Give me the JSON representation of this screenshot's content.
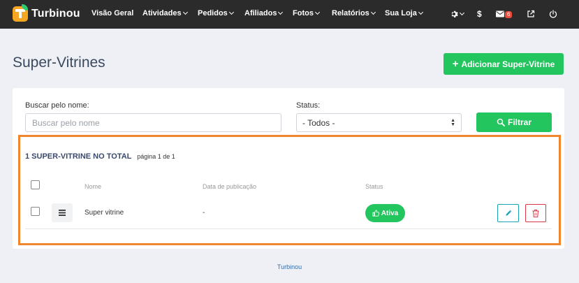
{
  "navbar": {
    "brand": "Turbinou",
    "items": [
      {
        "label": "Visão Geral"
      },
      {
        "label": "Atividades"
      },
      {
        "label": "Pedidos"
      },
      {
        "label": "Afiliados"
      },
      {
        "label": "Fotos"
      },
      {
        "label": "Relatórios"
      },
      {
        "label": "Sua Loja"
      }
    ],
    "icons": {
      "settings": "gear-icon",
      "billing": "dollar-icon",
      "messages": "envelope-icon",
      "external": "external-link-icon",
      "logout": "power-icon"
    },
    "messages_count": "6"
  },
  "page": {
    "title": "Super-Vitrines",
    "add_button": "Adicionar Super-Vitrine"
  },
  "filters": {
    "search_label": "Buscar pelo nome:",
    "search_placeholder": "Buscar pelo nome",
    "status_label": "Status:",
    "status_selected": "- Todos -",
    "filter_button": "Filtrar"
  },
  "results": {
    "total_text": "1 SUPER-VITRINE NO TOTAL",
    "page_text": "página 1 de 1",
    "columns": [
      "Nome",
      "Data de publicação",
      "Status"
    ],
    "rows": [
      {
        "name": "Super vitrine",
        "published": "-",
        "status": "Ativa"
      }
    ]
  },
  "footer": {
    "text": "Turbinou"
  },
  "colors": {
    "navbar": "#2b2b2b",
    "primary_green": "#22c55e",
    "highlight_orange": "#f0852d",
    "edit_teal": "#17a2b8",
    "delete_red": "#dc3545"
  }
}
